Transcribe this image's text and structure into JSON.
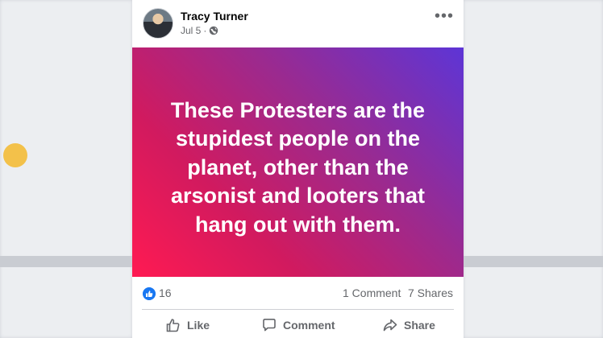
{
  "post": {
    "author": "Tracy Turner",
    "date": "Jul 5",
    "separator": "·",
    "privacy_icon": "globe-icon",
    "menu_label": "•••",
    "text": "These Protesters are the stupidest people on the planet, other than the arsonist and looters that hang out with them.",
    "background_gradient": [
      "#ff1a52",
      "#9b2a8f",
      "#5d35d6"
    ]
  },
  "stats": {
    "reactions": "16",
    "comments": "1 Comment",
    "shares": "7 Shares"
  },
  "actions": {
    "like": "Like",
    "comment": "Comment",
    "share": "Share"
  },
  "colors": {
    "accent": "#1877f2",
    "muted_text": "#65676b"
  }
}
